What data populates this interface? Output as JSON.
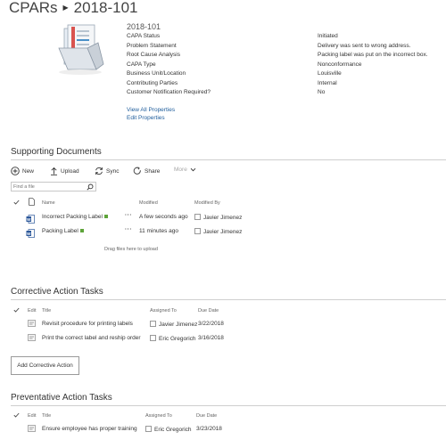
{
  "breadcrumb": {
    "root": "CPARs",
    "current": "2018-101"
  },
  "item": {
    "id": "2018-101",
    "properties": [
      {
        "label": "CAPA Status",
        "value": "Initiated"
      },
      {
        "label": "Problem Statement",
        "value": "Delivery was sent to wrong address."
      },
      {
        "label": "Root Cause Analysis",
        "value": "Packing label was put on the incorrect box."
      },
      {
        "label": "CAPA Type",
        "value": "Nonconformance"
      },
      {
        "label": "Business Unit/Location",
        "value": "Louisville"
      },
      {
        "label": "Contributing Parties",
        "value": "Internal"
      },
      {
        "label": "Customer Notification Required?",
        "value": "No"
      }
    ],
    "links": {
      "view_all": "View All Properties",
      "edit": "Edit Properties"
    }
  },
  "supporting_documents": {
    "title": "Supporting Documents",
    "commands": {
      "new": "New",
      "upload": "Upload",
      "sync": "Sync",
      "share": "Share",
      "more": "More"
    },
    "search_placeholder": "Find a file",
    "columns": {
      "name": "Name",
      "modified": "Modified",
      "modified_by": "Modified By"
    },
    "rows": [
      {
        "name": "Incorrect Packing Label",
        "modified": "A few seconds ago",
        "modified_by": "Javier Jimenez"
      },
      {
        "name": "Packing Label",
        "modified": "11 minutes ago",
        "modified_by": "Javier Jimenez"
      }
    ],
    "drop_hint": "Drag files here to upload"
  },
  "corrective": {
    "title": "Corrective Action Tasks",
    "columns": {
      "edit": "Edit",
      "title": "Title",
      "assigned_to": "Assigned To",
      "due_date": "Due Date"
    },
    "rows": [
      {
        "title": "Revisit procedure for printing labels",
        "assigned_to": "Javier Jimenez",
        "due_date": "3/22/2018"
      },
      {
        "title": "Print the correct label and reship order",
        "assigned_to": "Eric Gregorich",
        "due_date": "3/16/2018"
      }
    ],
    "add_button": "Add Corrective Action"
  },
  "preventative": {
    "title": "Preventative Action Tasks",
    "columns": {
      "edit": "Edit",
      "title": "Title",
      "assigned_to": "Assigned To",
      "due_date": "Due Date"
    },
    "rows": [
      {
        "title": "Ensure employee has proper training",
        "assigned_to": "Eric Gregorich",
        "due_date": "3/23/2018"
      }
    ]
  },
  "colors": {
    "link": "#1e5c9b",
    "new_badge": "#5ea43a",
    "rule": "#cfcfcf",
    "word_icon": "#2b579a"
  },
  "icons": [
    "documents-library-icon",
    "plus-circle-icon",
    "upload-arrow-icon",
    "sync-icon",
    "share-icon",
    "chevron-down-icon",
    "search-icon",
    "checkmark-icon",
    "document-icon",
    "word-doc-icon",
    "ellipsis-icon",
    "edit-item-icon"
  ]
}
